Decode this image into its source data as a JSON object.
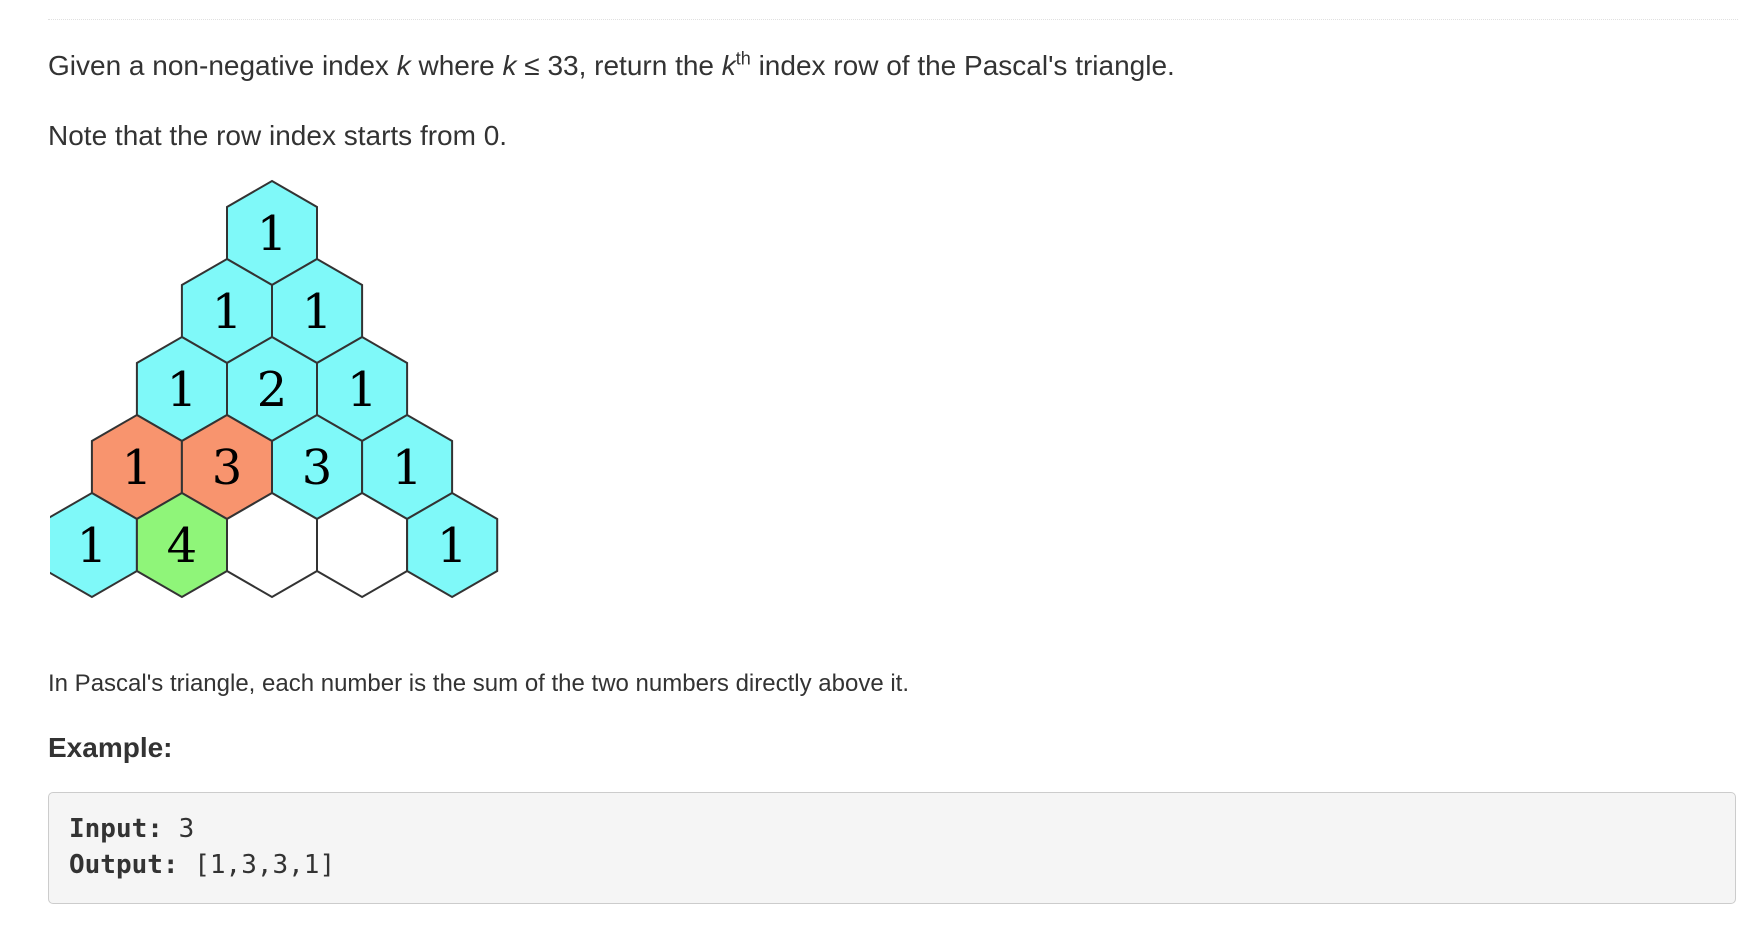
{
  "problem": {
    "p1": {
      "given": "Given a non-negative index ",
      "k1": "k",
      "where": " where ",
      "k2": "k",
      "le": " ≤ 33, return the ",
      "k3": "k",
      "th": "th",
      "rest": " index row of the Pascal's triangle."
    },
    "note": "Note that the row index starts from 0.",
    "caption": "In Pascal's triangle, each number is the sum of the two numbers directly above it."
  },
  "triangle": {
    "colors": {
      "cyan": "#7ff9f9",
      "orange": "#f8946e",
      "green": "#8ff579",
      "white": "#ffffff",
      "stroke": "#333333"
    },
    "rows": [
      [
        {
          "label": "1",
          "fill": "cyan"
        }
      ],
      [
        {
          "label": "1",
          "fill": "cyan"
        },
        {
          "label": "1",
          "fill": "cyan"
        }
      ],
      [
        {
          "label": "1",
          "fill": "cyan"
        },
        {
          "label": "2",
          "fill": "cyan"
        },
        {
          "label": "1",
          "fill": "cyan"
        }
      ],
      [
        {
          "label": "1",
          "fill": "orange"
        },
        {
          "label": "3",
          "fill": "orange"
        },
        {
          "label": "3",
          "fill": "cyan"
        },
        {
          "label": "1",
          "fill": "cyan"
        }
      ],
      [
        {
          "label": "1",
          "fill": "cyan"
        },
        {
          "label": "4",
          "fill": "green"
        },
        {
          "label": "",
          "fill": "white"
        },
        {
          "label": "",
          "fill": "white"
        },
        {
          "label": "1",
          "fill": "cyan"
        }
      ]
    ]
  },
  "example": {
    "heading": "Example:",
    "input_label": "Input:",
    "input_value": " 3",
    "output_label": "Output:",
    "output_value": " [1,3,3,1]"
  }
}
